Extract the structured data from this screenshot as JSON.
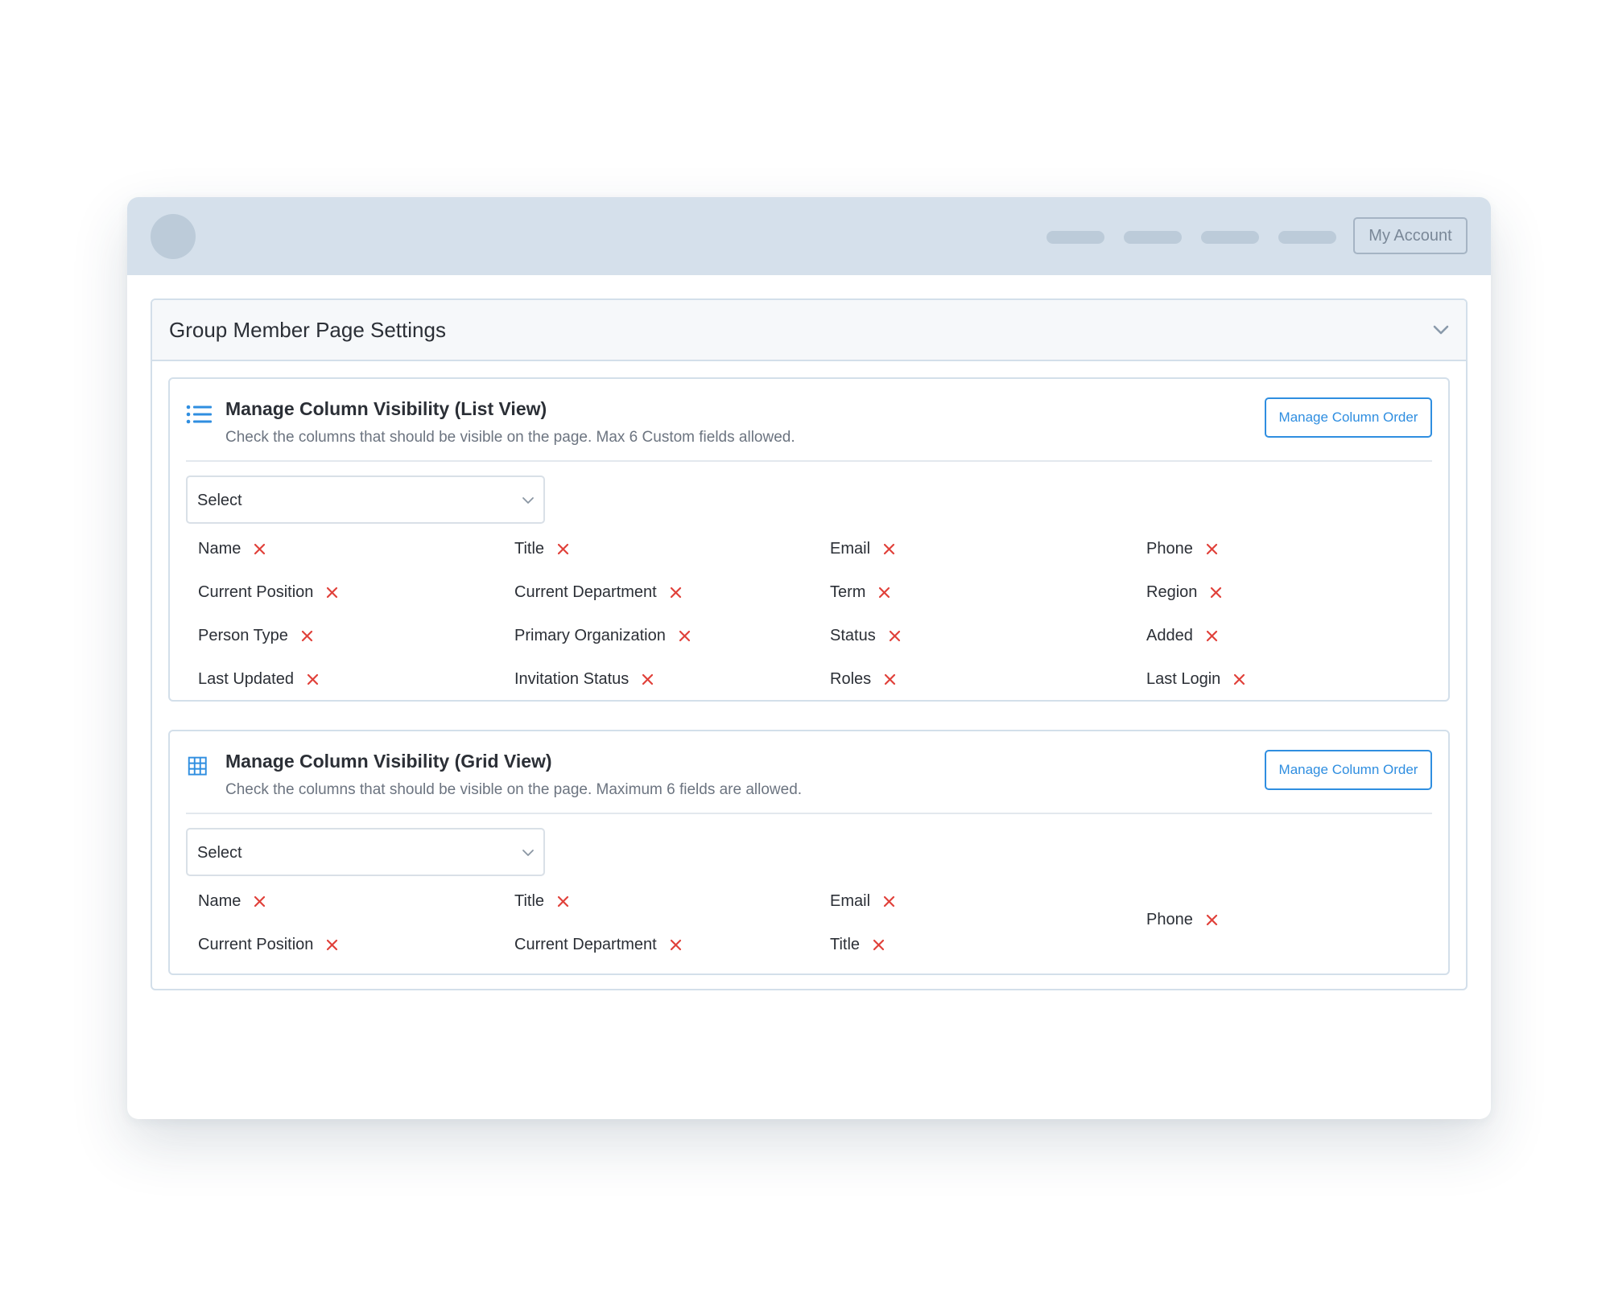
{
  "header": {
    "account_label": "My Account"
  },
  "panel": {
    "title": "Group Member Page Settings"
  },
  "list_view": {
    "title": "Manage Column Visibility (List View)",
    "description": "Check the columns that should be visible on the page. Max 6 Custom fields allowed.",
    "order_button": "Manage Column Order",
    "select_placeholder": "Select",
    "fields": [
      "Name",
      "Title",
      "Email",
      "Phone",
      "Current Position",
      "Current Department",
      "Term",
      "Region",
      "Person Type",
      "Primary Organization",
      "Status",
      "Added",
      "Last Updated",
      "Invitation Status",
      "Roles",
      "Last Login"
    ]
  },
  "grid_view": {
    "title": "Manage Column Visibility (Grid View)",
    "description": "Check the columns that should be visible on the page. Maximum 6 fields are allowed.",
    "order_button": "Manage Column Order",
    "select_placeholder": "Select",
    "fields": [
      "Name",
      "Title",
      "Email",
      "Phone",
      "Current Position",
      "Current Department",
      "Title"
    ]
  },
  "colors": {
    "accent": "#2f8ee0",
    "remove": "#e0413a",
    "header_bg": "#d5e0eb",
    "border": "#d3dfea"
  }
}
